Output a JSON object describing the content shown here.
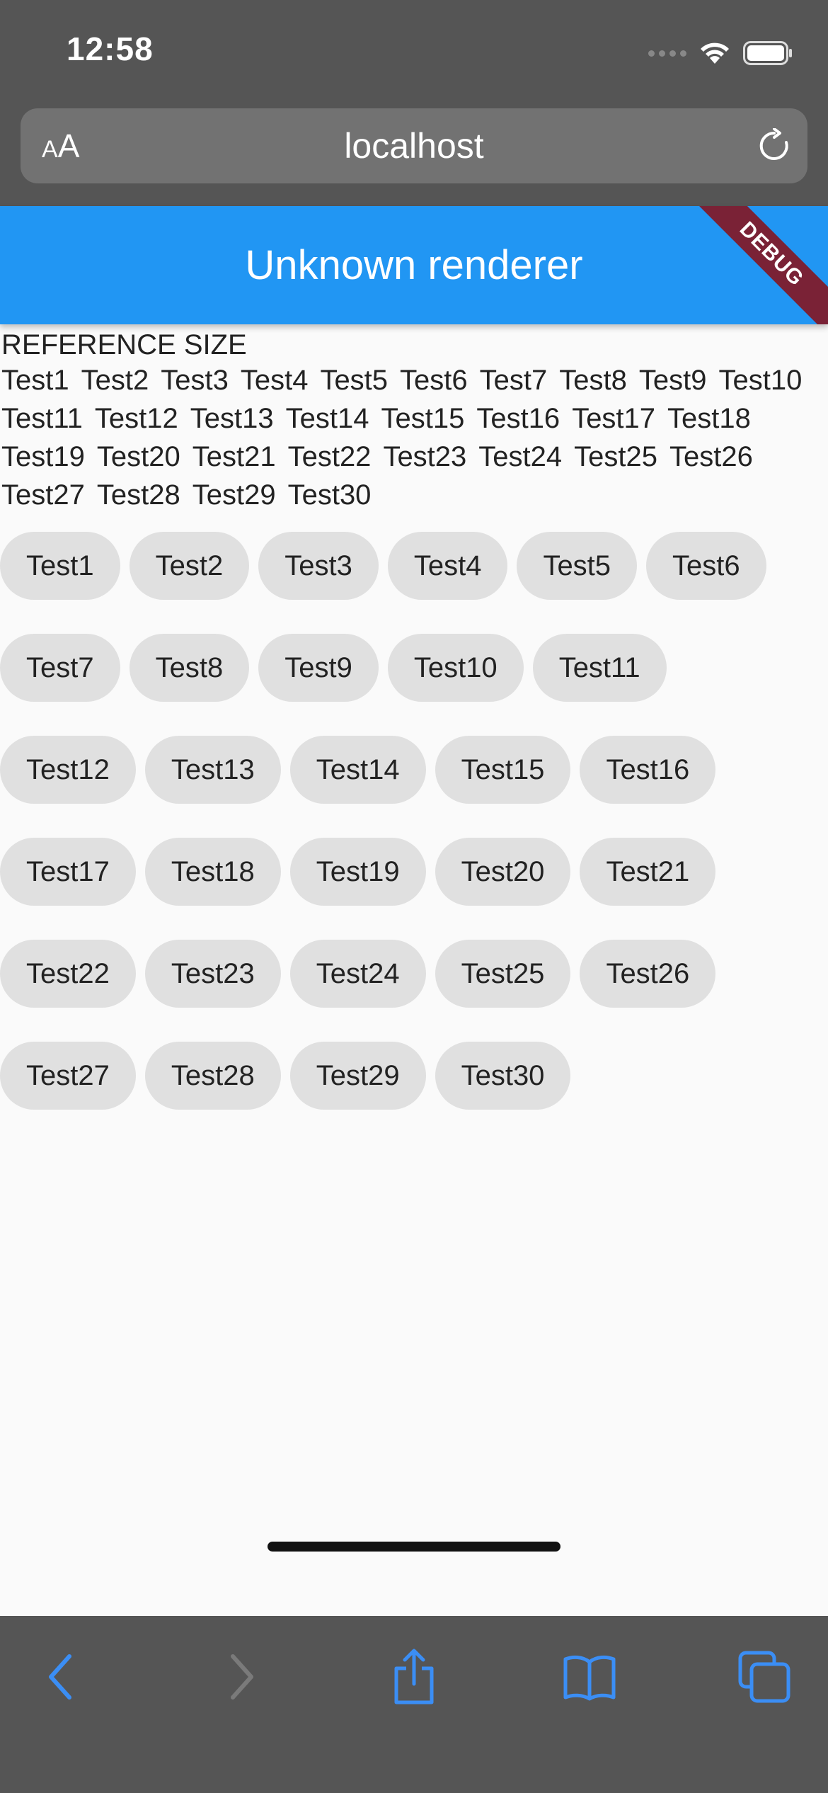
{
  "status_bar": {
    "time": "12:58"
  },
  "browser": {
    "text_size_label_small": "A",
    "text_size_label_large": "A",
    "url": "localhost"
  },
  "app_bar": {
    "title": "Unknown renderer",
    "debug_label": "DEBUG"
  },
  "reference": {
    "heading": "REFERENCE SIZE",
    "words": [
      "Test1",
      "Test2",
      "Test3",
      "Test4",
      "Test5",
      "Test6",
      "Test7",
      "Test8",
      "Test9",
      "Test10",
      "Test11",
      "Test12",
      "Test13",
      "Test14",
      "Test15",
      "Test16",
      "Test17",
      "Test18",
      "Test19",
      "Test20",
      "Test21",
      "Test22",
      "Test23",
      "Test24",
      "Test25",
      "Test26",
      "Test27",
      "Test28",
      "Test29",
      "Test30"
    ]
  },
  "chips": [
    [
      "Test1",
      "Test2",
      "Test3",
      "Test4",
      "Test5",
      "Test6"
    ],
    [
      "Test7",
      "Test8",
      "Test9",
      "Test10",
      "Test11"
    ],
    [
      "Test12",
      "Test13",
      "Test14",
      "Test15",
      "Test16"
    ],
    [
      "Test17",
      "Test18",
      "Test19",
      "Test20",
      "Test21"
    ],
    [
      "Test22",
      "Test23",
      "Test24",
      "Test25",
      "Test26"
    ],
    [
      "Test27",
      "Test28",
      "Test29",
      "Test30"
    ]
  ],
  "toolbar": {
    "icons": [
      "back-icon",
      "forward-icon",
      "share-icon",
      "bookmarks-icon",
      "tabs-icon"
    ]
  },
  "colors": {
    "accent": "#2196f3",
    "debug_banner": "#7a2236",
    "chrome": "#555555",
    "chip": "#e0e0e0",
    "toolbar_icon": "#3b8ef5"
  }
}
